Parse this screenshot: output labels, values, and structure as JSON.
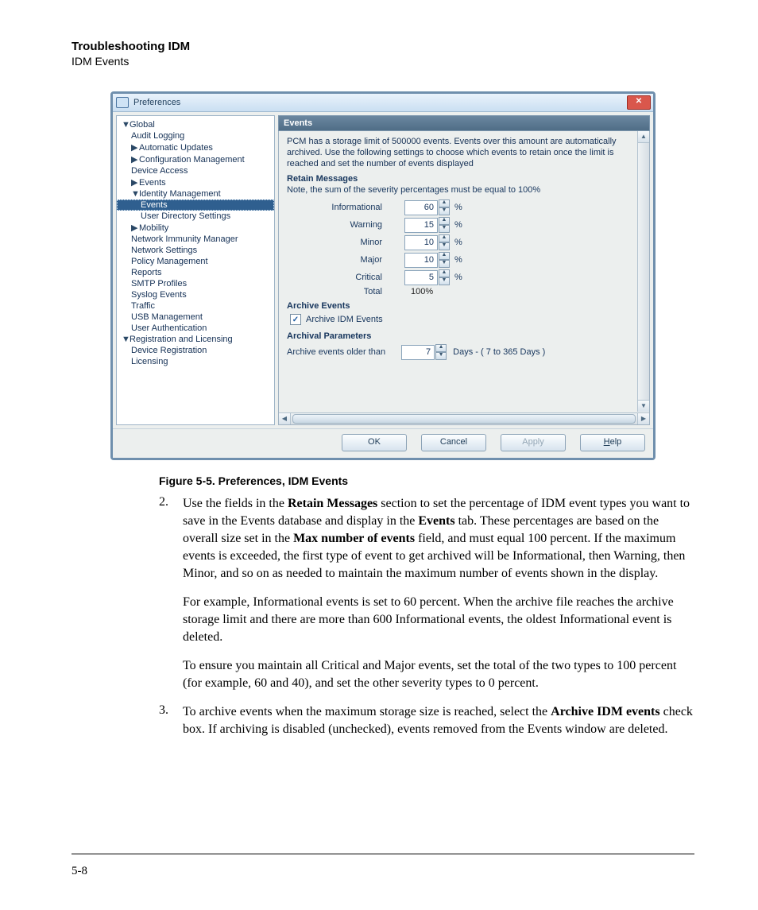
{
  "header": {
    "line1": "Troubleshooting IDM",
    "line2": "IDM Events"
  },
  "dialog": {
    "title": "Preferences",
    "close": "✕",
    "tree": {
      "global": "Global",
      "audit": "Audit Logging",
      "auto": "Automatic Updates",
      "config": "Configuration Management",
      "device": "Device Access",
      "events": "Events",
      "idm": "Identity Management",
      "idm_events": "Events",
      "idm_user": "User Directory Settings",
      "mobility": "Mobility",
      "nim": "Network Immunity Manager",
      "net": "Network Settings",
      "policy": "Policy Management",
      "reports": "Reports",
      "smtp": "SMTP Profiles",
      "syslog": "Syslog Events",
      "traffic": "Traffic",
      "usb": "USB Management",
      "userauth": "User Authentication",
      "reg": "Registration and Licensing",
      "devreg": "Device Registration",
      "lic": "Licensing"
    },
    "panel": {
      "title": "Events",
      "intro": "PCM has a storage limit of 500000 events.  Events over this amount are automatically archived.  Use the following settings to choose which events to retain once the limit is reached and set the number of events displayed",
      "retain_hdr": "Retain Messages",
      "retain_note": "Note, the sum of the severity percentages must be equal to 100%",
      "rows": {
        "info_lbl": "Informational",
        "info_val": "60",
        "warn_lbl": "Warning",
        "warn_val": "15",
        "minor_lbl": "Minor",
        "minor_val": "10",
        "major_lbl": "Major",
        "major_val": "10",
        "crit_lbl": "Critical",
        "crit_val": "5",
        "total_lbl": "Total",
        "total_val": "100%"
      },
      "pct": "%",
      "archive_hdr": "Archive Events",
      "archive_chk": "Archive IDM Events",
      "params_hdr": "Archival Parameters",
      "older_lbl": "Archive events older than",
      "older_val": "7",
      "older_after": "Days  -  ( 7 to 365 Days )"
    },
    "buttons": {
      "ok": "OK",
      "cancel": "Cancel",
      "apply": "Apply",
      "help_pre": "H",
      "help_post": "elp"
    }
  },
  "caption": "Figure 5-5. Preferences, IDM Events",
  "body": {
    "s2a": "Use the fields in the ",
    "s2b": "Retain Messages",
    "s2c": " section to set the percentage of IDM event types you want to save in the Events database and display in the ",
    "s2d": "Events",
    "s2e": " tab. These percentages are based on the overall size set in the ",
    "s2f": "Max number of events",
    "s2g": " field, and must equal 100 percent. If the maximum events is exceeded, the first type of event to get archived will be Informational, then Warning, then Minor, and so on as needed to maintain the maximum number of events shown in the display.",
    "s2p2": "For example, Informational events is set to 60 percent. When the archive file reaches the archive storage limit and there are more than 600 Informational events, the oldest Informational event is deleted.",
    "s2p3": "To ensure you maintain all Critical and Major events, set the total of the two types to 100 percent (for example, 60 and 40), and set the other severity types to 0 percent.",
    "s3a": "To archive events when the maximum storage size is reached, select the ",
    "s3b": "Archive IDM events",
    "s3c": " check box. If archiving is disabled (unchecked), events removed from the Events window are deleted.",
    "n2": "2.",
    "n3": "3."
  },
  "page_number": "5-8"
}
